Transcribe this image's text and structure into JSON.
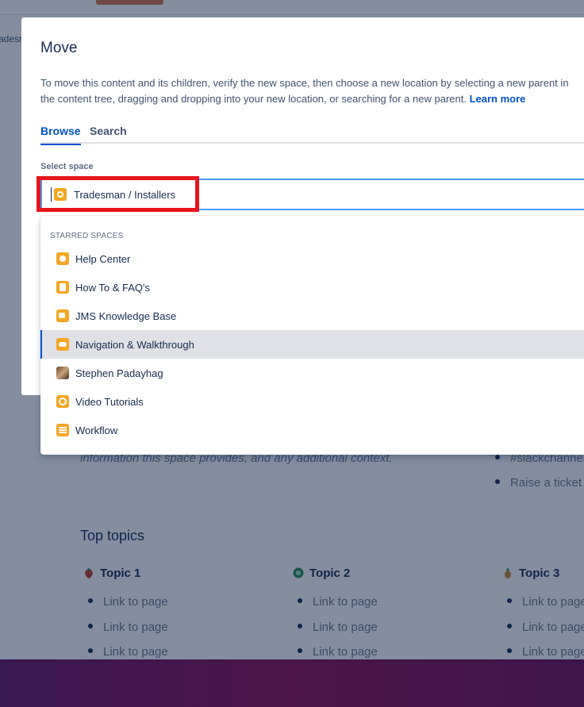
{
  "background": {
    "side_label": "adesr",
    "description_tail": "information this space provides, and any additional context.",
    "right_list": [
      "#slackchannel",
      "Raise a ticket"
    ],
    "top_topics_title": "Top topics",
    "topics": [
      {
        "title": "Topic 1",
        "links": [
          "Link to page",
          "Link to page",
          "Link to page"
        ],
        "icon": "strawberry-icon",
        "color": "#c0392b"
      },
      {
        "title": "Topic 2",
        "links": [
          "Link to page",
          "Link to page",
          "Link to page"
        ],
        "icon": "lifebuoy-icon",
        "color": "#2e8b57"
      },
      {
        "title": "Topic 3",
        "links": [
          "Link to page",
          "Link to page",
          "Link to page"
        ],
        "icon": "pineapple-icon",
        "color": "#c98a2b"
      }
    ]
  },
  "modal": {
    "title": "Move",
    "description_line1": "To move this content and its children, verify the new space, then choose a new location by selecting a new parent in",
    "description_line2": "the content tree, dragging and dropping into your new location, or searching for a new parent.",
    "learn_more": "Learn more",
    "tabs": [
      {
        "label": "Browse",
        "active": true
      },
      {
        "label": "Search",
        "active": false
      }
    ],
    "select_space_label": "Select space",
    "selected_space": "Tradesman / Installers"
  },
  "dropdown": {
    "group_label": "STARRED SPACES",
    "items": [
      {
        "label": "Help Center",
        "icon": "help-center-space-icon"
      },
      {
        "label": "How To & FAQ's",
        "icon": "book-space-icon"
      },
      {
        "label": "JMS Knowledge Base",
        "icon": "knowledge-base-space-icon"
      },
      {
        "label": "Navigation & Walkthrough",
        "icon": "navigation-space-icon",
        "active": true
      },
      {
        "label": "Stephen Padayhag",
        "icon": "user-avatar-icon"
      },
      {
        "label": "Video Tutorials",
        "icon": "video-space-icon"
      },
      {
        "label": "Workflow",
        "icon": "workflow-space-icon"
      }
    ]
  },
  "colors": {
    "accent": "#0052cc",
    "focus_border": "#4c9aff",
    "highlight_border": "#e8141b",
    "space_icon": "#f5a623"
  }
}
